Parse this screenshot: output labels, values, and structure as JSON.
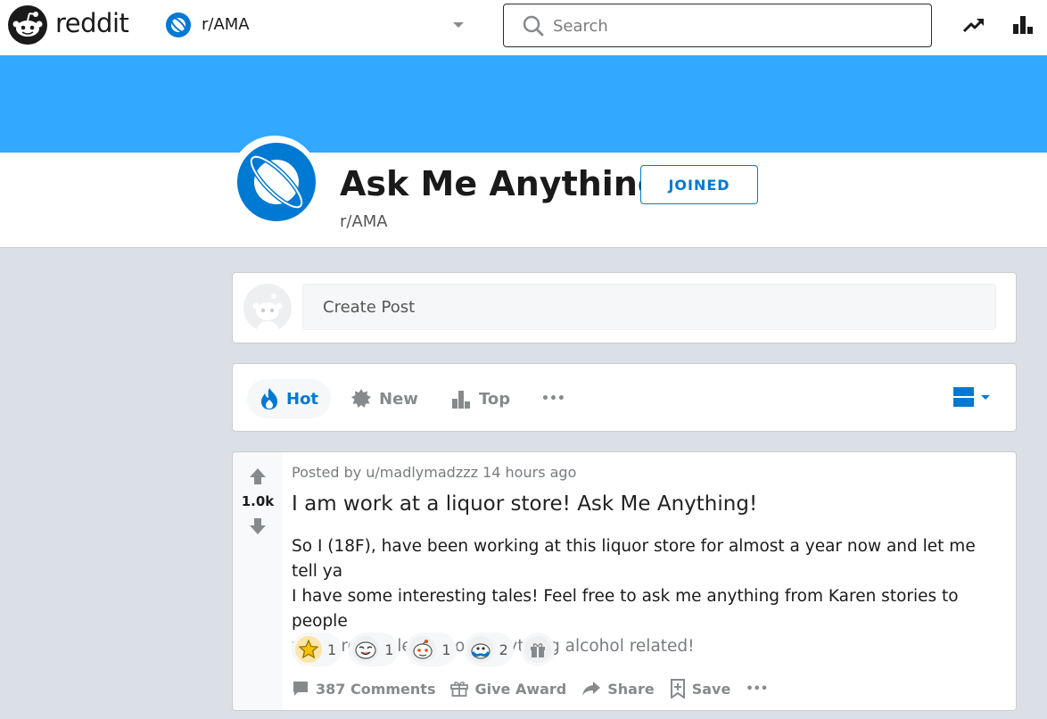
{
  "brand": {
    "word": "reddit"
  },
  "community_selector": {
    "name": "r/AMA"
  },
  "search": {
    "placeholder": "Search"
  },
  "subreddit": {
    "title": "Ask Me Anything",
    "handle": "r/AMA",
    "join_label": "JOINED"
  },
  "create_post": {
    "placeholder": "Create Post"
  },
  "sort": {
    "hot": "Hot",
    "new": "New",
    "top": "Top",
    "more": "•••"
  },
  "post": {
    "votes": "1.0k",
    "meta": "Posted by u/madlymadzzz 14 hours ago",
    "title": "I am work at a liquor store! Ask Me Anything!",
    "body_line1": "So I (18F), have been working at this liquor store for almost a year now and let me tell ya",
    "body_line2": "I have some interesting tales! Feel free to ask me anything from Karen stories to people",
    "body_line3": "who are clueless about anything alcohol related!",
    "awards": [
      {
        "icon": "star-award-icon",
        "count": "1"
      },
      {
        "icon": "laughing-award-icon",
        "count": "1"
      },
      {
        "icon": "snoo-award-icon",
        "count": "1"
      },
      {
        "icon": "wholesome-award-icon",
        "count": "2"
      }
    ],
    "actions": {
      "comments": "387 Comments",
      "give_award": "Give Award",
      "share": "Share",
      "save": "Save",
      "more": "•••"
    }
  },
  "colors": {
    "accent": "#0079d3",
    "banner": "#33a8ff",
    "background": "#dae0e6"
  }
}
